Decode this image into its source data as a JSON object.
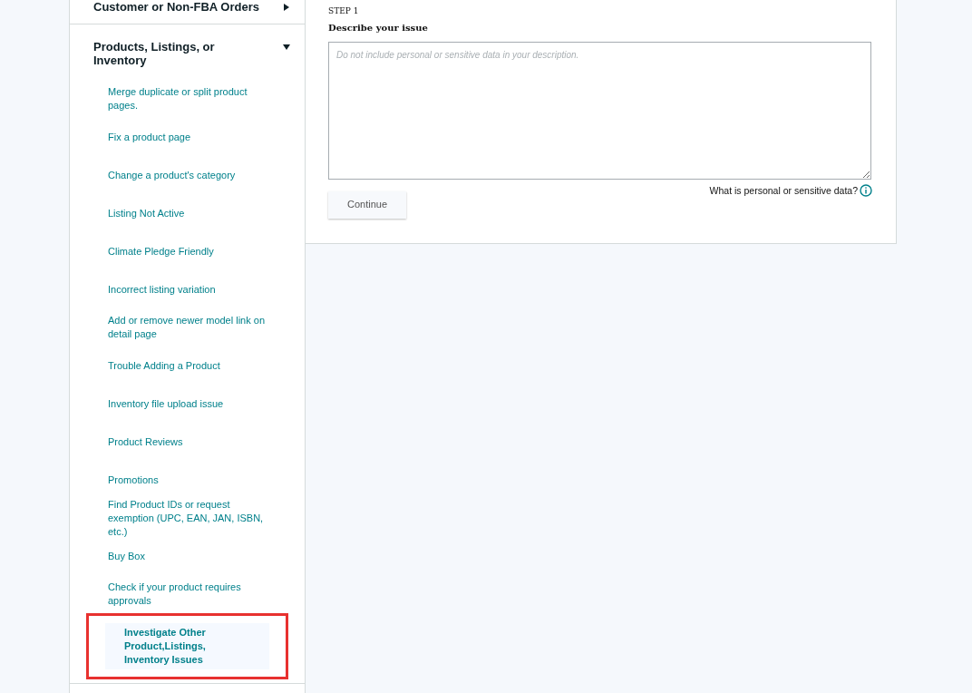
{
  "sidebar": {
    "categories": [
      {
        "label": "Customer or Non-FBA Orders",
        "expanded": false
      },
      {
        "label": "Products, Listings, or Inventory",
        "expanded": true,
        "items": [
          {
            "label": "Merge duplicate or split product pages.",
            "selected": false,
            "highlighted": false
          },
          {
            "label": "Fix a product page",
            "selected": false,
            "highlighted": false
          },
          {
            "label": "Change a product's category",
            "selected": false,
            "highlighted": false
          },
          {
            "label": "Listing Not Active",
            "selected": false,
            "highlighted": false
          },
          {
            "label": "Climate Pledge Friendly",
            "selected": false,
            "highlighted": false
          },
          {
            "label": "Incorrect listing variation",
            "selected": false,
            "highlighted": false
          },
          {
            "label": "Add or remove newer model link on detail page",
            "selected": false,
            "highlighted": false
          },
          {
            "label": "Trouble Adding a Product",
            "selected": false,
            "highlighted": false
          },
          {
            "label": "Inventory file upload issue",
            "selected": false,
            "highlighted": false
          },
          {
            "label": "Product Reviews",
            "selected": false,
            "highlighted": false
          },
          {
            "label": "Promotions",
            "selected": false,
            "highlighted": false
          },
          {
            "label": "Find Product IDs or request exemption (UPC, EAN, JAN, ISBN, etc.)",
            "selected": false,
            "highlighted": false
          },
          {
            "label": "Buy Box",
            "selected": false,
            "highlighted": false
          },
          {
            "label": "Check if your product requires approvals",
            "selected": false,
            "highlighted": false
          },
          {
            "label": "Investigate Other Product,Listings, Inventory Issues",
            "selected": true,
            "highlighted": true
          }
        ]
      }
    ]
  },
  "form": {
    "step": "STEP 1",
    "heading": "Describe your issue",
    "description": {
      "placeholder": "Do not include personal or sensitive data in your description."
    },
    "help_link": "What is personal or sensitive data?",
    "continue_button": "Continue"
  }
}
